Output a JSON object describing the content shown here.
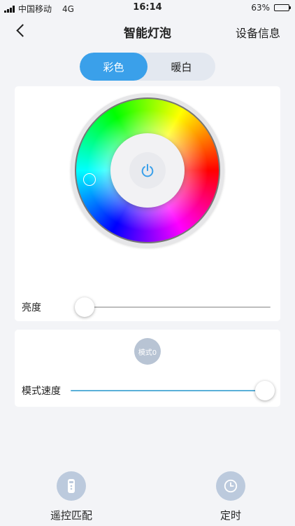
{
  "status_bar": {
    "carrier": "中国移动",
    "network": "4G",
    "time": "16:14",
    "battery_percent": "63%",
    "battery_level": 0.63
  },
  "nav": {
    "title": "智能灯泡",
    "right_action": "设备信息"
  },
  "segment": {
    "tabs": [
      "彩色",
      "暖白"
    ],
    "active_index": 0,
    "active_color": "#3aa0ea"
  },
  "color_wheel": {
    "center_icon": "power-icon"
  },
  "brightness": {
    "label": "亮度",
    "value": 0.0
  },
  "mode": {
    "button_label": "模式0",
    "speed_label": "模式速度",
    "speed_value": 1.0,
    "track_color": "#5ab0d8"
  },
  "bottom_bar": {
    "items": [
      {
        "label": "遥控匹配",
        "icon": "remote-control-icon"
      },
      {
        "label": "定时",
        "icon": "clock-icon"
      }
    ]
  }
}
